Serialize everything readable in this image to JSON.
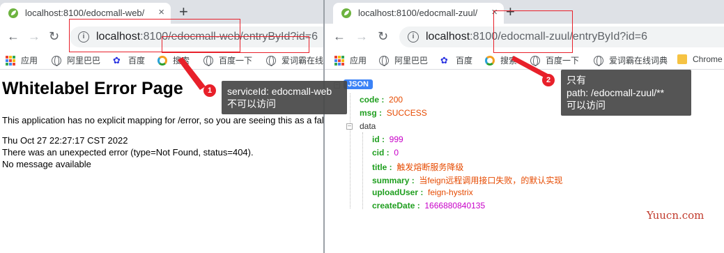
{
  "left_browser": {
    "tab_title": "localhost:8100/edocmall-web/",
    "tab_close": "×",
    "new_tab": "+",
    "nav": {
      "back": "←",
      "forward": "→",
      "reload": "↻"
    },
    "url_host": "localhost",
    "url_rest": ":8100/edocmall-web/entryById?id=6",
    "bookmarks": [
      "应用",
      "阿里巴巴",
      "百度",
      "搜索",
      "百度一下",
      "爱词霸在线词典"
    ],
    "page": {
      "title": "Whitelabel Error Page",
      "line1": "This application has no explicit mapping for /error, so you are seeing this as a fallback.",
      "line2": "Thu Oct 27 22:27:17 CST 2022",
      "line3": "There was an unexpected error (type=Not Found, status=404).",
      "line4": "No message available"
    }
  },
  "right_browser": {
    "tab_title": "localhost:8100/edocmall-zuul/",
    "tab_close": "×",
    "new_tab": "+",
    "nav": {
      "back": "←",
      "forward": "→",
      "reload": "↻"
    },
    "url_host": "localhost",
    "url_rest": ":8100/edocmall-zuul/entryById?id=6",
    "bookmarks": [
      "应用",
      "阿里巴巴",
      "百度",
      "搜索",
      "百度一下",
      "爱词霸在线词典",
      "Chrome"
    ],
    "json": {
      "badge": "JSON",
      "code_key": "code :",
      "code_val": "200",
      "msg_key": "msg :",
      "msg_val": "SUCCESS",
      "data_key": "data",
      "id_key": "id :",
      "id_val": "999",
      "cid_key": "cid :",
      "cid_val": "0",
      "title_key": "title :",
      "title_val": "触发熔断服务降级",
      "summary_key": "summary :",
      "summary_val": "当feign远程调用接口失败，的默认实现",
      "uploadUser_key": "uploadUser :",
      "uploadUser_val": "feign-hystrix",
      "createDate_key": "createDate :",
      "createDate_val": "1666880840135"
    }
  },
  "annotations": {
    "marker1": "1",
    "callout1_line1": "serviceId: edocmall-web",
    "callout1_line2": "不可以访问",
    "marker2": "2",
    "callout2_line1": "只有",
    "callout2_line2": "path: /edocmall-zuul/**",
    "callout2_line3": "可以访问"
  },
  "watermark": "Yuucn.com",
  "colors": {
    "annotation_red": "#e8202a",
    "json_key": "#1e9e1e",
    "json_number": "#c800c8",
    "json_string": "#e64a00",
    "json_badge": "#3b82f6"
  }
}
